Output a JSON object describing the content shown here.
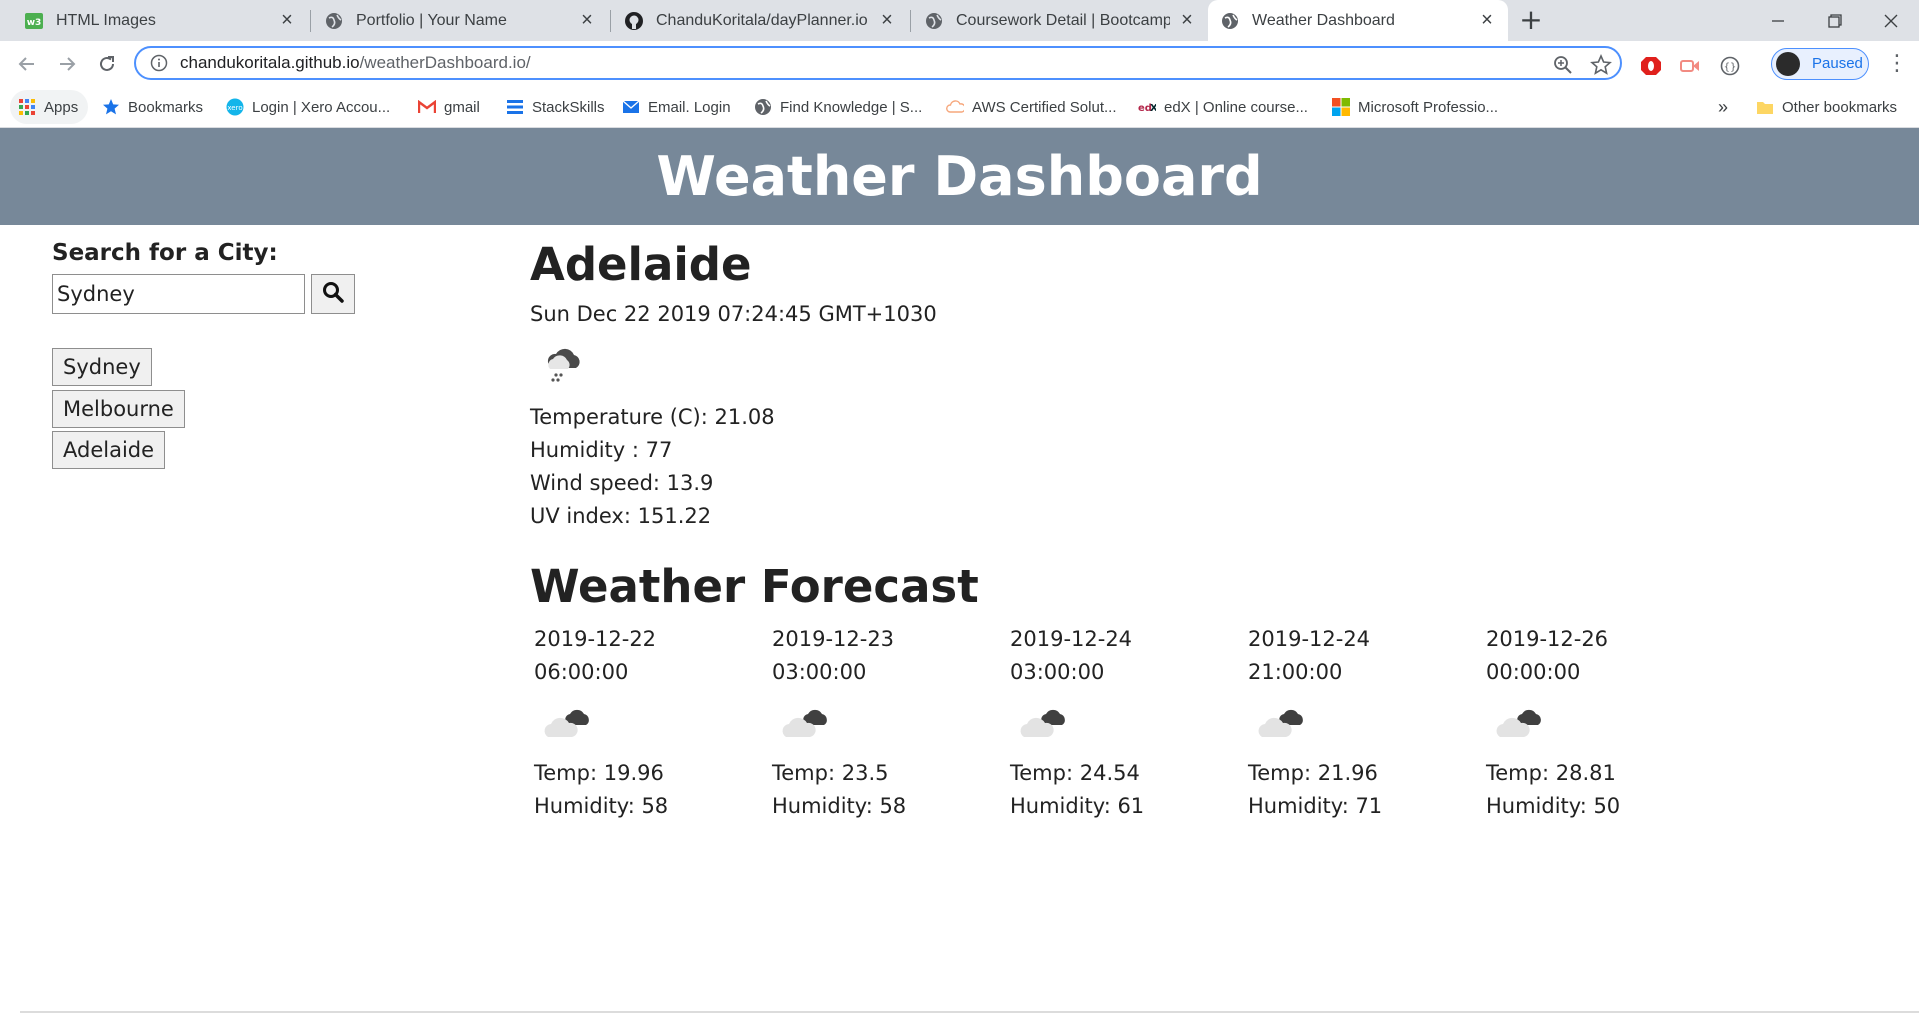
{
  "browser": {
    "tabs": [
      {
        "title": "HTML Images",
        "icon": "w3schools-icon",
        "active": false
      },
      {
        "title": "Portfolio | Your Name",
        "icon": "globe-icon",
        "active": false
      },
      {
        "title": "ChanduKoritala/dayPlanner.io",
        "icon": "github-icon",
        "active": false
      },
      {
        "title": "Coursework Detail | Bootcamp Sp",
        "icon": "globe-icon",
        "active": false
      },
      {
        "title": "Weather Dashboard",
        "icon": "globe-icon",
        "active": true
      }
    ],
    "url_host": "chandukoritala.github.io",
    "url_path": "/weatherDashboard.io/",
    "profile_label": "Paused",
    "bookmarks": [
      {
        "label": "Apps",
        "icon": "apps-grid-icon"
      },
      {
        "label": "Bookmarks",
        "icon": "star-icon"
      },
      {
        "label": "Login | Xero Accou...",
        "icon": "xero-icon"
      },
      {
        "label": "gmail",
        "icon": "gmail-icon"
      },
      {
        "label": "StackSkills",
        "icon": "stackskills-icon"
      },
      {
        "label": "Email. Login",
        "icon": "email-icon"
      },
      {
        "label": "Find Knowledge | S...",
        "icon": "globe-icon"
      },
      {
        "label": "AWS Certified Solut...",
        "icon": "cloud-icon"
      },
      {
        "label": "edX | Online course...",
        "icon": "edx-icon"
      },
      {
        "label": "Microsoft Professio...",
        "icon": "microsoft-icon"
      }
    ],
    "more_bookmarks": "»",
    "other_bookmarks": "Other bookmarks"
  },
  "page": {
    "title": "Weather Dashboard",
    "search": {
      "label": "Search for a City:",
      "value": "Sydney"
    },
    "history": [
      "Sydney",
      "Melbourne",
      "Adelaide"
    ],
    "current": {
      "city": "Adelaide",
      "date": "Sun Dec 22 2019 07:24:45 GMT+1030",
      "icon": "rain-cloud-icon",
      "temperature": "Temperature (C): 21.08",
      "humidity": "Humidity : 77",
      "wind": "Wind speed: 13.9",
      "uv": "UV index: 151.22"
    },
    "forecast_title": "Weather Forecast",
    "forecast": [
      {
        "date": "2019-12-22",
        "time": "06:00:00",
        "icon": "broken-clouds-icon",
        "temp": "Temp: 19.96",
        "humidity": "Humidity: 58"
      },
      {
        "date": "2019-12-23",
        "time": "03:00:00",
        "icon": "broken-clouds-icon",
        "temp": "Temp: 23.5",
        "humidity": "Humidity: 58"
      },
      {
        "date": "2019-12-24",
        "time": "03:00:00",
        "icon": "broken-clouds-icon",
        "temp": "Temp: 24.54",
        "humidity": "Humidity: 61"
      },
      {
        "date": "2019-12-24",
        "time": "21:00:00",
        "icon": "broken-clouds-icon",
        "temp": "Temp: 21.96",
        "humidity": "Humidity: 71"
      },
      {
        "date": "2019-12-26",
        "time": "00:00:00",
        "icon": "broken-clouds-icon",
        "temp": "Temp: 28.81",
        "humidity": "Humidity: 50"
      }
    ]
  },
  "colors": {
    "header_bg": "#778899",
    "header_text": "#ffffff",
    "omnibox_border": "#4d90fe"
  }
}
